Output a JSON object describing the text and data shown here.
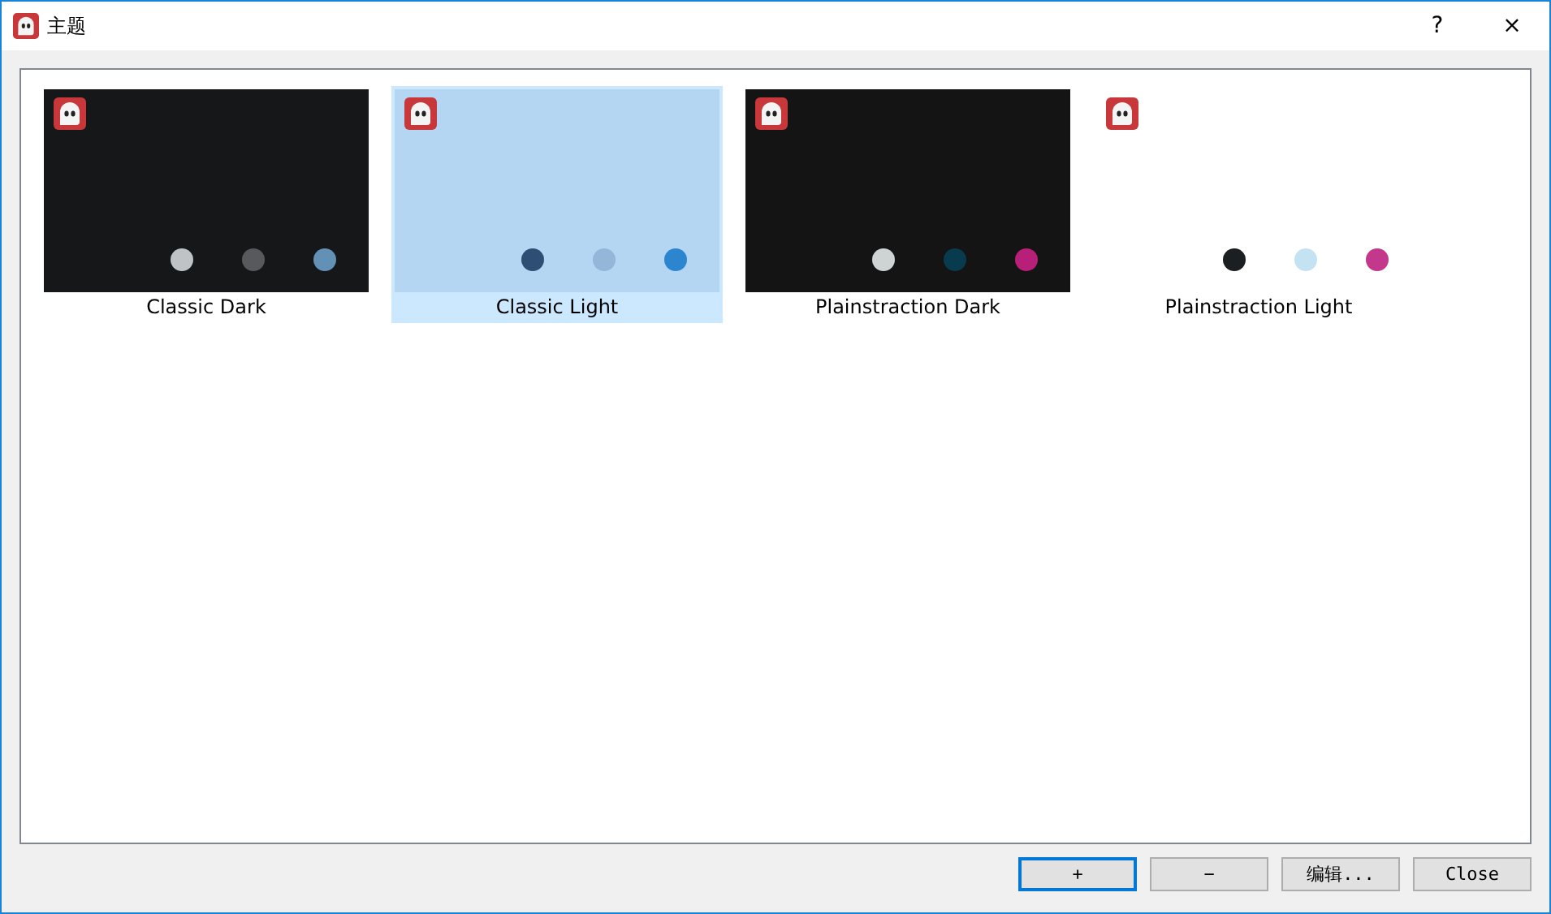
{
  "window": {
    "title": "主题",
    "help": "?",
    "close": "×"
  },
  "themes": [
    {
      "name": "Classic Dark",
      "selected": false,
      "color": "#161719",
      "swatches": [
        {
          "color": "#c0c3c6"
        },
        {
          "color": "#58595c"
        },
        {
          "color": "#6391b6"
        }
      ]
    },
    {
      "name": "Classic Light",
      "selected": true,
      "color": "#b5d6f3",
      "swatches": [
        {
          "color": "#2d4f74"
        },
        {
          "color": "#93b6d9"
        },
        {
          "color": "#2b86cf"
        }
      ]
    },
    {
      "name": "Plainstraction Dark",
      "selected": false,
      "color": "#141414",
      "swatches": [
        {
          "color": "#ced3d3"
        },
        {
          "color": "#083b4e"
        },
        {
          "color": "#b81f78"
        }
      ]
    },
    {
      "name": "Plainstraction Light",
      "selected": false,
      "color": "#ffffff",
      "swatches": [
        {
          "color": "#1c1f22"
        },
        {
          "color": "#c3e3f3"
        },
        {
          "color": "#c3388a"
        }
      ]
    }
  ],
  "buttons": [
    {
      "label": "+",
      "focused": true
    },
    {
      "label": "−",
      "focused": false
    },
    {
      "label": "编辑...",
      "focused": false
    },
    {
      "label": "Close",
      "focused": false
    }
  ]
}
